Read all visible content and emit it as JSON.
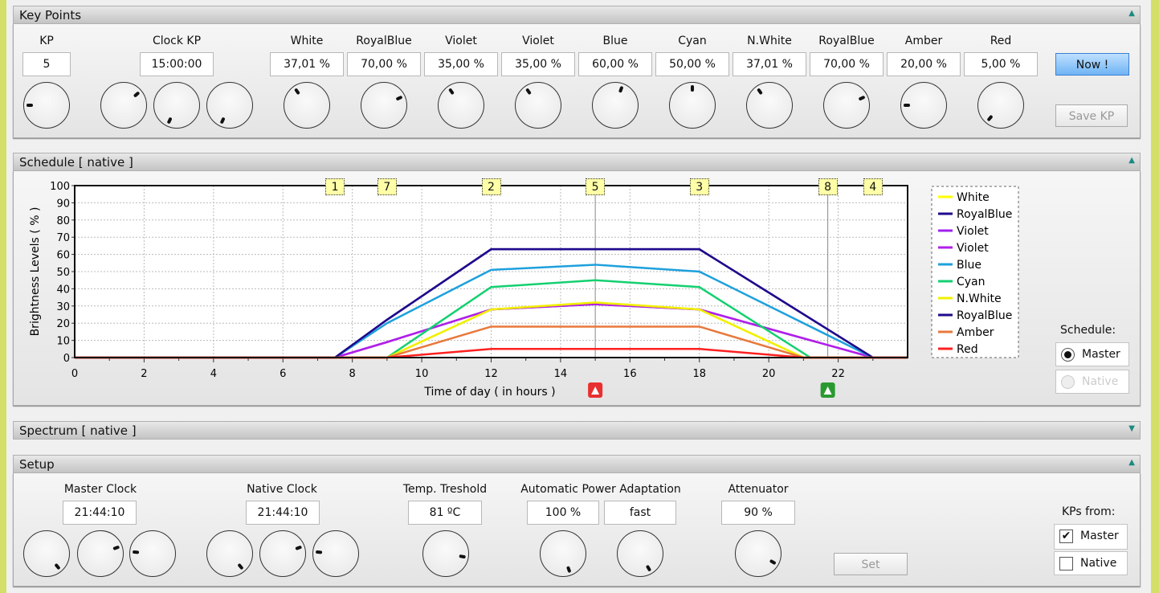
{
  "key_points": {
    "title": "Key Points",
    "kp_label": "KP",
    "kp_value": "5",
    "clock_label": "Clock  KP",
    "clock_value": "15:00:00",
    "channels": [
      {
        "name": "White",
        "value": "37,01 %"
      },
      {
        "name": "RoyalBlue",
        "value": "70,00 %"
      },
      {
        "name": "Violet",
        "value": "35,00 %"
      },
      {
        "name": "Violet",
        "value": "35,00 %"
      },
      {
        "name": "Blue",
        "value": "60,00 %"
      },
      {
        "name": "Cyan",
        "value": "50,00 %"
      },
      {
        "name": "N.White",
        "value": "37,01 %"
      },
      {
        "name": "RoyalBlue",
        "value": "70,00 %"
      },
      {
        "name": "Amber",
        "value": "20,00 %"
      },
      {
        "name": "Red",
        "value": "5,00 %"
      }
    ],
    "now_button": "Now !",
    "save_button": "Save KP"
  },
  "schedule": {
    "title": "Schedule  [ native ]",
    "mode_label": "Schedule:",
    "master": "Master",
    "native": "Native",
    "selected": "Master"
  },
  "spectrum": {
    "title": "Spectrum  [ native ]"
  },
  "setup": {
    "title": "Setup",
    "master_clock_label": "Master Clock",
    "master_clock": "21:44:10",
    "native_clock_label": "Native  Clock",
    "native_clock": "21:44:10",
    "temp_label": "Temp. Treshold",
    "temp": "81 ºC",
    "apa_label": "Automatic  Power Adaptation",
    "apa_value": "100 %",
    "apa_speed": "fast",
    "att_label": "Attenuator",
    "att": "90 %",
    "set_button": "Set",
    "kps_from_label": "KPs from:",
    "kps_master": "Master",
    "kps_native": "Native",
    "kps_master_checked": true,
    "kps_native_checked": false
  },
  "chart_data": {
    "type": "line",
    "xlabel": "Time of day  ( in hours )",
    "ylabel": "Brightness Levels  ( % )",
    "xlim": [
      0,
      24
    ],
    "ylim": [
      0,
      100
    ],
    "xticks": [
      0,
      2,
      4,
      6,
      8,
      10,
      12,
      14,
      16,
      18,
      20,
      22
    ],
    "yticks": [
      0,
      10,
      20,
      30,
      40,
      50,
      60,
      70,
      80,
      90,
      100
    ],
    "grid": true,
    "legend": "right",
    "key_points": [
      {
        "label": "1",
        "x": 7.5
      },
      {
        "label": "7",
        "x": 9
      },
      {
        "label": "2",
        "x": 12
      },
      {
        "label": "5",
        "x": 15
      },
      {
        "label": "3",
        "x": 18
      },
      {
        "label": "8",
        "x": 21.7
      },
      {
        "label": "4",
        "x": 23
      }
    ],
    "markers": [
      {
        "x": 15,
        "color": "#e83030"
      },
      {
        "x": 21.7,
        "color": "#2a9a30"
      }
    ],
    "series": [
      {
        "name": "White",
        "color": "#ffff00",
        "points": [
          [
            0,
            0
          ],
          [
            9,
            0
          ],
          [
            12,
            28
          ],
          [
            15,
            32
          ],
          [
            18,
            28
          ],
          [
            21,
            0
          ],
          [
            24,
            0
          ]
        ]
      },
      {
        "name": "RoyalBlue",
        "color": "#1e0a8c",
        "points": [
          [
            0,
            0
          ],
          [
            7.5,
            0
          ],
          [
            9,
            22
          ],
          [
            12,
            63
          ],
          [
            18,
            63
          ],
          [
            23,
            0
          ],
          [
            24,
            0
          ]
        ]
      },
      {
        "name": "Violet",
        "color": "#a020f0",
        "points": [
          [
            0,
            0
          ],
          [
            7.5,
            0
          ],
          [
            9,
            9
          ],
          [
            12,
            28
          ],
          [
            15,
            31
          ],
          [
            18,
            28
          ],
          [
            23,
            0
          ],
          [
            24,
            0
          ]
        ]
      },
      {
        "name": "Violet",
        "color": "#b020e8",
        "points": [
          [
            0,
            0
          ],
          [
            7.5,
            0
          ],
          [
            9,
            9
          ],
          [
            12,
            28
          ],
          [
            15,
            31
          ],
          [
            18,
            28
          ],
          [
            23,
            0
          ],
          [
            24,
            0
          ]
        ]
      },
      {
        "name": "Blue",
        "color": "#1ea0dc",
        "points": [
          [
            0,
            0
          ],
          [
            7.5,
            0
          ],
          [
            9,
            20
          ],
          [
            12,
            51
          ],
          [
            15,
            54
          ],
          [
            18,
            50
          ],
          [
            23,
            0
          ],
          [
            24,
            0
          ]
        ]
      },
      {
        "name": "Cyan",
        "color": "#14d070",
        "points": [
          [
            0,
            0
          ],
          [
            9,
            0
          ],
          [
            12,
            41
          ],
          [
            15,
            45
          ],
          [
            18,
            41
          ],
          [
            21.2,
            0
          ],
          [
            24,
            0
          ]
        ]
      },
      {
        "name": "N.White",
        "color": "#f0f000",
        "points": [
          [
            0,
            0
          ],
          [
            9,
            0
          ],
          [
            12,
            28
          ],
          [
            15,
            32
          ],
          [
            18,
            28
          ],
          [
            21,
            0
          ],
          [
            24,
            0
          ]
        ]
      },
      {
        "name": "RoyalBlue",
        "color": "#1e0a8c",
        "points": [
          [
            0,
            0
          ],
          [
            7.5,
            0
          ],
          [
            9,
            22
          ],
          [
            12,
            63
          ],
          [
            18,
            63
          ],
          [
            23,
            0
          ],
          [
            24,
            0
          ]
        ]
      },
      {
        "name": "Amber",
        "color": "#e8783c",
        "points": [
          [
            0,
            0
          ],
          [
            9,
            0
          ],
          [
            12,
            18
          ],
          [
            18,
            18
          ],
          [
            21,
            0
          ],
          [
            24,
            0
          ]
        ]
      },
      {
        "name": "Red",
        "color": "#ff2020",
        "points": [
          [
            0,
            0
          ],
          [
            9,
            0
          ],
          [
            12,
            5
          ],
          [
            18,
            5
          ],
          [
            21,
            0
          ],
          [
            24,
            0
          ]
        ]
      }
    ]
  }
}
